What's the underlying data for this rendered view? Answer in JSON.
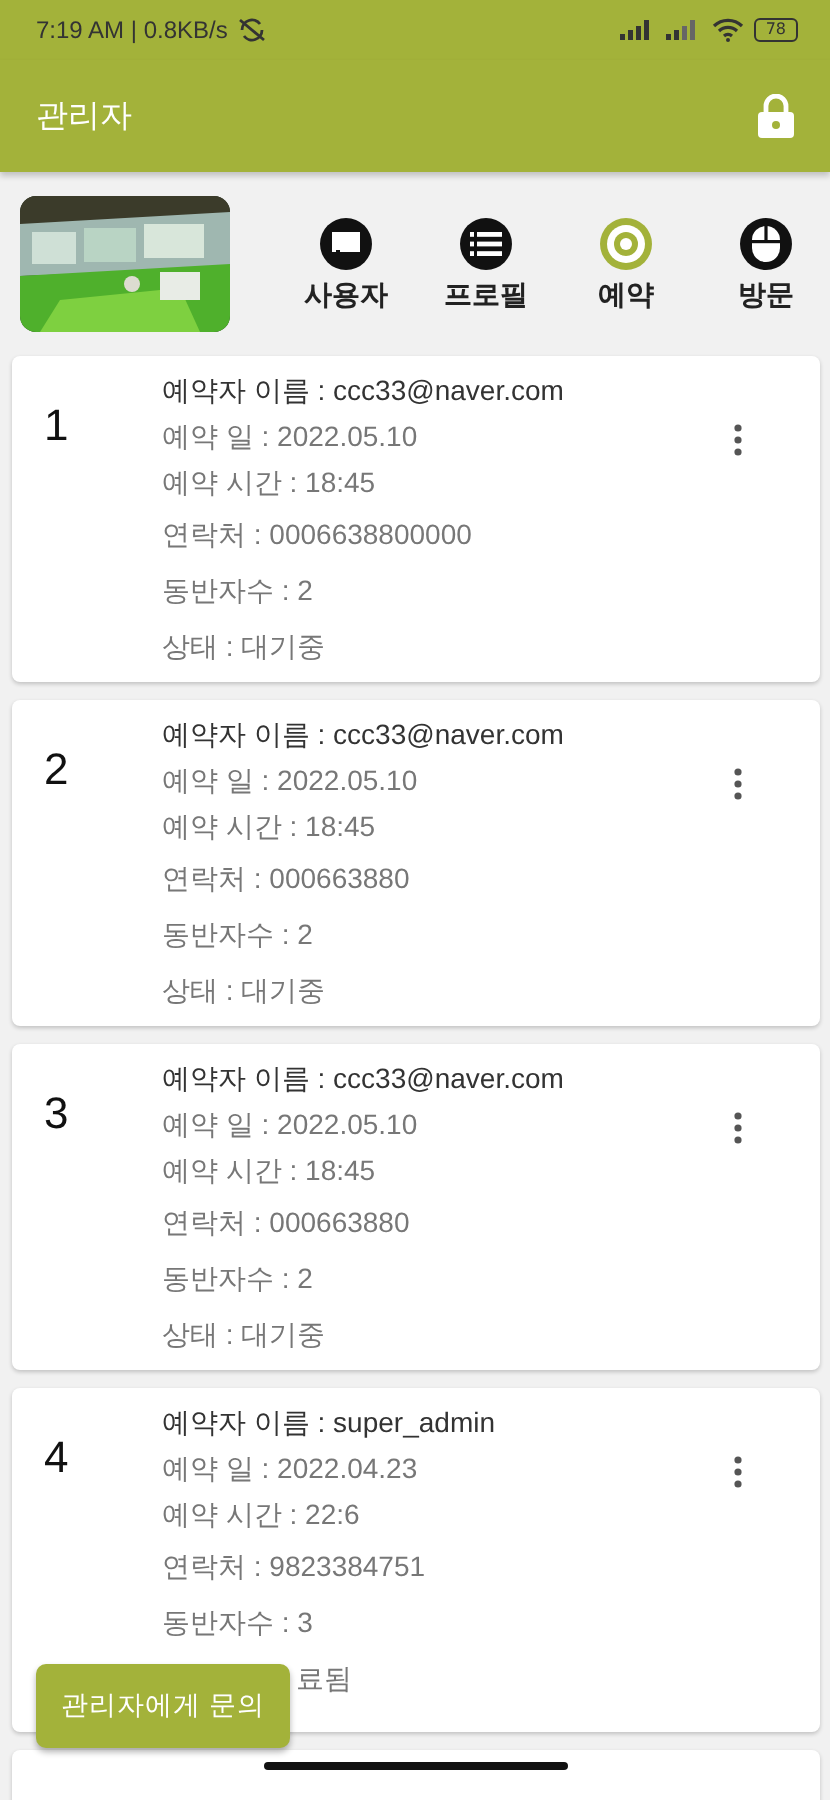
{
  "status_bar": {
    "time": "7:19 AM | 0.8KB/s",
    "battery": "78"
  },
  "app_bar": {
    "title": "관리자"
  },
  "tabs": [
    {
      "label": "사용자",
      "kind": "user",
      "selected": false
    },
    {
      "label": "프로필",
      "kind": "profile",
      "selected": false
    },
    {
      "label": "예약",
      "kind": "booking",
      "selected": true
    },
    {
      "label": "방문",
      "kind": "visit",
      "selected": false
    }
  ],
  "reservations": [
    {
      "number": "1",
      "name": "예약자 이름 : ccc33@naver.com",
      "date": "예약 일 : 2022.05.10",
      "time": "예약 시간 : 18:45",
      "contact": "연락처 : 0006638800000",
      "companions": "동반자수 : 2",
      "status": "상태 : 대기중",
      "covered": false
    },
    {
      "number": "2",
      "name": "예약자 이름 : ccc33@naver.com",
      "date": "예약 일 : 2022.05.10",
      "time": "예약 시간 : 18:45",
      "contact": "연락처 : 000663880",
      "companions": "동반자수 : 2",
      "status": "상태 : 대기중",
      "covered": false
    },
    {
      "number": "3",
      "name": "예약자 이름 : ccc33@naver.com",
      "date": "예약 일 : 2022.05.10",
      "time": "예약 시간 : 18:45",
      "contact": "연락처 : 000663880",
      "companions": "동반자수 : 2",
      "status": "상태 : 대기중",
      "covered": false
    },
    {
      "number": "4",
      "name": "예약자 이름 : super_admin",
      "date": "예약 일 : 2022.04.23",
      "time": "예약 시간 : 22:6",
      "contact": "연락처 : 9823384751",
      "companions": "동반자수 : 3",
      "status": "료됨",
      "covered": true
    }
  ],
  "fab": {
    "label": "관리자에게 문의"
  }
}
